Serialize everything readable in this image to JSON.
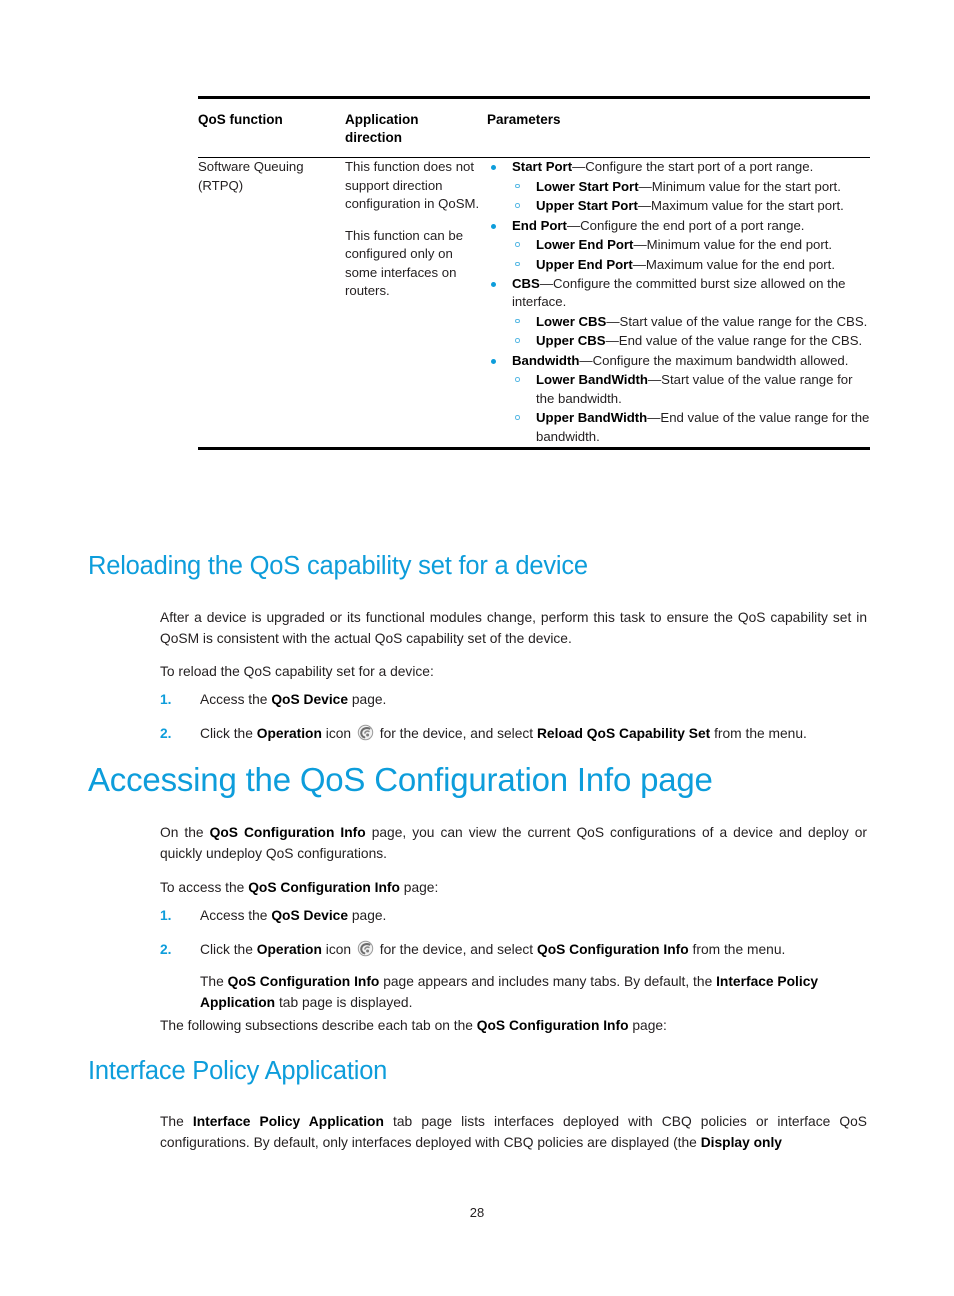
{
  "table": {
    "headers": {
      "col1": "QoS function",
      "col2": "Application direction",
      "col3": "Parameters"
    },
    "row": {
      "function": "Software Queuing (RTPQ)",
      "direction_p1": "This function does not support direction configuration in QoSM.",
      "direction_p2": "This function can be configured only on some interfaces on routers.",
      "parameters": [
        {
          "term": "Start Port",
          "desc": "—Configure the start port of a port range.",
          "sub": [
            {
              "term": "Lower Start Port",
              "desc": "—Minimum value for the start port."
            },
            {
              "term": "Upper Start Port",
              "desc": "—Maximum value for the start port."
            }
          ]
        },
        {
          "term": "End Port",
          "desc": "—Configure the end port of a port range.",
          "sub": [
            {
              "term": "Lower End Port",
              "desc": "—Minimum value for the end port."
            },
            {
              "term": "Upper End Port",
              "desc": "—Maximum value for the end port."
            }
          ]
        },
        {
          "term": "CBS",
          "desc": "—Configure the committed burst size allowed on the interface.",
          "sub": [
            {
              "term": "Lower CBS",
              "desc": "—Start value of the value range for the CBS."
            },
            {
              "term": "Upper CBS",
              "desc": "—End value of the value range for the CBS."
            }
          ]
        },
        {
          "term": "Bandwidth",
          "desc": "—Configure the maximum bandwidth allowed.",
          "sub": [
            {
              "term": "Lower BandWidth",
              "desc": "—Start value of the value range for the bandwidth."
            },
            {
              "term": "Upper BandWidth",
              "desc": "—End value of the value range for the bandwidth."
            }
          ]
        }
      ]
    }
  },
  "section_reload": {
    "heading": "Reloading the QoS capability set for a device",
    "intro": "After a device is upgraded or its functional modules change, perform this task to ensure the QoS capability set in QoSM is consistent with the actual QoS capability set of the device.",
    "lead_in": "To reload the QoS capability set for a device:",
    "step1": {
      "num": "1.",
      "pre": "Access the ",
      "bold": "QoS Device",
      "post": " page."
    },
    "step2": {
      "num": "2.",
      "pre": "Click the ",
      "bold1": "Operation",
      "mid": " icon ",
      "icon": "operation-icon",
      "post1": " for the device, and select ",
      "bold2": "Reload QoS Capability Set",
      "post2": " from the menu."
    }
  },
  "section_accessing": {
    "heading": "Accessing the QoS Configuration Info page",
    "intro_pre": "On the ",
    "intro_bold": "QoS Configuration Info",
    "intro_post": " page, you can view the current QoS configurations of a device and deploy or quickly undeploy QoS configurations.",
    "lead_pre": "To access the ",
    "lead_bold": "QoS Configuration Info",
    "lead_post": " page:",
    "step1": {
      "num": "1.",
      "pre": "Access the ",
      "bold": "QoS Device",
      "post": " page."
    },
    "step2": {
      "num": "2.",
      "pre": "Click the ",
      "bold1": "Operation",
      "mid": " icon ",
      "icon": "operation-icon",
      "post1": " for the device, and select ",
      "bold2": "QoS Configuration Info",
      "post2": " from the menu."
    },
    "substep_pre": "The ",
    "substep_bold1": "QoS Configuration Info",
    "substep_mid": " page appears and includes many tabs. By default, the ",
    "substep_bold2": "Interface Policy Application",
    "substep_post": " tab page is displayed.",
    "closing_pre": "The following subsections describe each tab on the ",
    "closing_bold": "QoS Configuration Info",
    "closing_post": " page:"
  },
  "section_interface": {
    "heading": "Interface Policy Application",
    "body_pre": "The ",
    "body_bold1": "Interface Policy Application",
    "body_mid": " tab page lists interfaces deployed with CBQ policies or interface QoS configurations. By default, only interfaces deployed with CBQ policies are displayed (the ",
    "body_bold2": "Display only"
  },
  "footer": {
    "page_number": "28"
  },
  "colors": {
    "heading_blue": "#0d9ddb",
    "bullet_blue": "#0d9ddb",
    "sub_bullet_blue": "#59b9e4",
    "body_text": "#231f20",
    "rule_black": "#000000"
  }
}
